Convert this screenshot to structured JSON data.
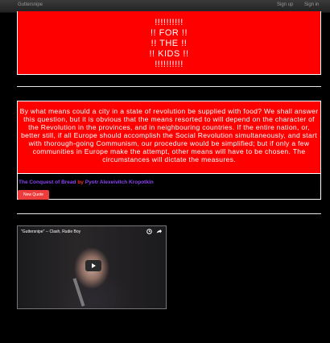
{
  "topbar": {
    "brand": "Guttersnipe",
    "signup_label": "Sign up",
    "signin_label": "Sign in"
  },
  "banner": {
    "lines": [
      "!!!!!!!!!!",
      "!! FOR !!",
      "!! THE !!",
      "!! KIDS !!",
      "!!!!!!!!!!"
    ]
  },
  "quote": {
    "text": "By what means could a city in a state of revolution be supplied with food? We shall answer this question, but it is obvious that the means resorted to will depend on the character of the Revolution in the provinces, and in neighbouring countries. If the entire nation, or, better still, if all Europe should accomplish the Social Revolution simultaneously, and start with thorough-going Communism, our procedure would be simplified; but if only a few communities in Europe make the attempt, other means will have to be chosen. The circumstances will dictate the measures.",
    "book": "The Conquest of Bread",
    "by_label": "by",
    "author": "Pyotr Alexeivitch Kropotkin",
    "new_quote_label": "New Quote"
  },
  "video": {
    "title": "\"Guttersnipe\" -- Clash, Rudie Boy",
    "icons": [
      "clock-icon",
      "share-icon",
      "play-icon"
    ]
  },
  "colors": {
    "background": "#000000",
    "accent_red": "#ff0000",
    "link_purple": "#8844ee",
    "button_red": "#ee3b3b"
  }
}
